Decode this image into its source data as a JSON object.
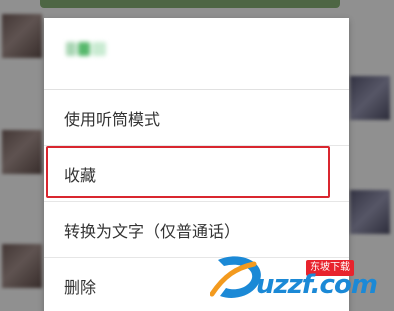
{
  "menu": {
    "sender_name": "",
    "items": [
      {
        "label": "使用听筒模式"
      },
      {
        "label": "收藏"
      },
      {
        "label": "转换为文字（仅普通话）"
      },
      {
        "label": "删除"
      }
    ],
    "highlighted_item": "收藏"
  },
  "watermark": {
    "tag": "东坡下载",
    "text": "uzzf.com",
    "logo_icon": "swoosh-d-logo"
  },
  "colors": {
    "highlight": "#d9262f",
    "chat_bubble": "#7fa56f",
    "watermark_blue": "#1b89d6",
    "watermark_red": "#e8232d"
  }
}
